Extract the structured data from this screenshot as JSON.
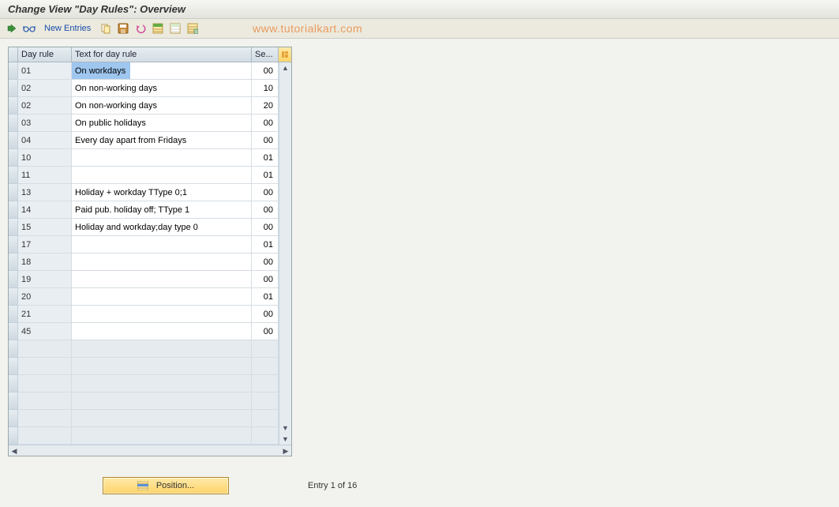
{
  "header": {
    "title": "Change View \"Day Rules\": Overview"
  },
  "toolbar": {
    "new_entries": "New Entries",
    "watermark": "www.tutorialkart.com"
  },
  "table": {
    "headers": {
      "c1": "Day rule",
      "c2": "Text for day rule",
      "c3": "Se..."
    },
    "rows": [
      {
        "rule": "01",
        "text": "On workdays",
        "se": "00",
        "first_selected": true
      },
      {
        "rule": "02",
        "text": "On non-working days",
        "se": "10"
      },
      {
        "rule": "02",
        "text": "On non-working days",
        "se": "20"
      },
      {
        "rule": "03",
        "text": "On public holidays",
        "se": "00"
      },
      {
        "rule": "04",
        "text": "Every day apart from Fridays",
        "se": "00"
      },
      {
        "rule": "10",
        "text": "",
        "se": "01"
      },
      {
        "rule": "11",
        "text": "",
        "se": "01"
      },
      {
        "rule": "13",
        "text": "Holiday + workday TType 0;1",
        "se": "00"
      },
      {
        "rule": "14",
        "text": "Paid pub. holiday off; TType 1",
        "se": "00"
      },
      {
        "rule": "15",
        "text": "Holiday and workday;day type 0",
        "se": "00"
      },
      {
        "rule": "17",
        "text": "",
        "se": "01"
      },
      {
        "rule": "18",
        "text": "",
        "se": "00"
      },
      {
        "rule": "19",
        "text": "",
        "se": "00"
      },
      {
        "rule": "20",
        "text": "",
        "se": "01"
      },
      {
        "rule": "21",
        "text": "",
        "se": "00"
      },
      {
        "rule": "45",
        "text": "",
        "se": "00"
      }
    ],
    "blank_rows": 6
  },
  "footer": {
    "position_label": "Position...",
    "entry_text": "Entry 1 of 16"
  },
  "icons": {
    "toggle": "toggle-icon",
    "glasses": "glasses-icon",
    "copy": "copy-icon",
    "save": "save-icon",
    "undo": "undo-icon",
    "select": "select-icon",
    "deselect": "deselect-icon",
    "print": "print-icon"
  }
}
